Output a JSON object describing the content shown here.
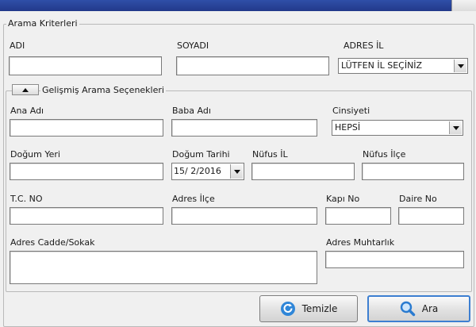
{
  "colors": {
    "titlebar": "#2b48a0",
    "accent": "#3d7fd1"
  },
  "search_criteria": {
    "legend": "Arama Kriterleri",
    "first_name_label": "ADI",
    "first_name_value": "",
    "last_name_label": "SOYADI",
    "last_name_value": "",
    "province_label": "ADRES İL",
    "province_selected": "LÜTFEN İL SEÇİNİZ"
  },
  "advanced": {
    "legend": "Gelişmiş Arama Seçenekleri",
    "mother_name_label": "Ana Adı",
    "father_name_label": "Baba Adı",
    "gender_label": "Cinsiyeti",
    "gender_selected": "HEPSİ",
    "birthplace_label": "Doğum Yeri",
    "birthdate_label": "Doğum Tarihi",
    "birthdate_value": "15/ 2/2016",
    "registry_province_label": "Nüfus İL",
    "registry_district_label": "Nüfus İlçe",
    "tc_no_label": "T.C. NO",
    "address_district_label": "Adres İlçe",
    "door_no_label": "Kapı No",
    "apartment_no_label": "Daire No",
    "street_label": "Adres Cadde/Sokak",
    "neighborhood_label": "Adres Muhtarlık"
  },
  "buttons": {
    "clear_label": "Temizle",
    "search_label": "Ara",
    "clear_icon": "refresh-icon",
    "search_icon": "magnifier-icon"
  }
}
